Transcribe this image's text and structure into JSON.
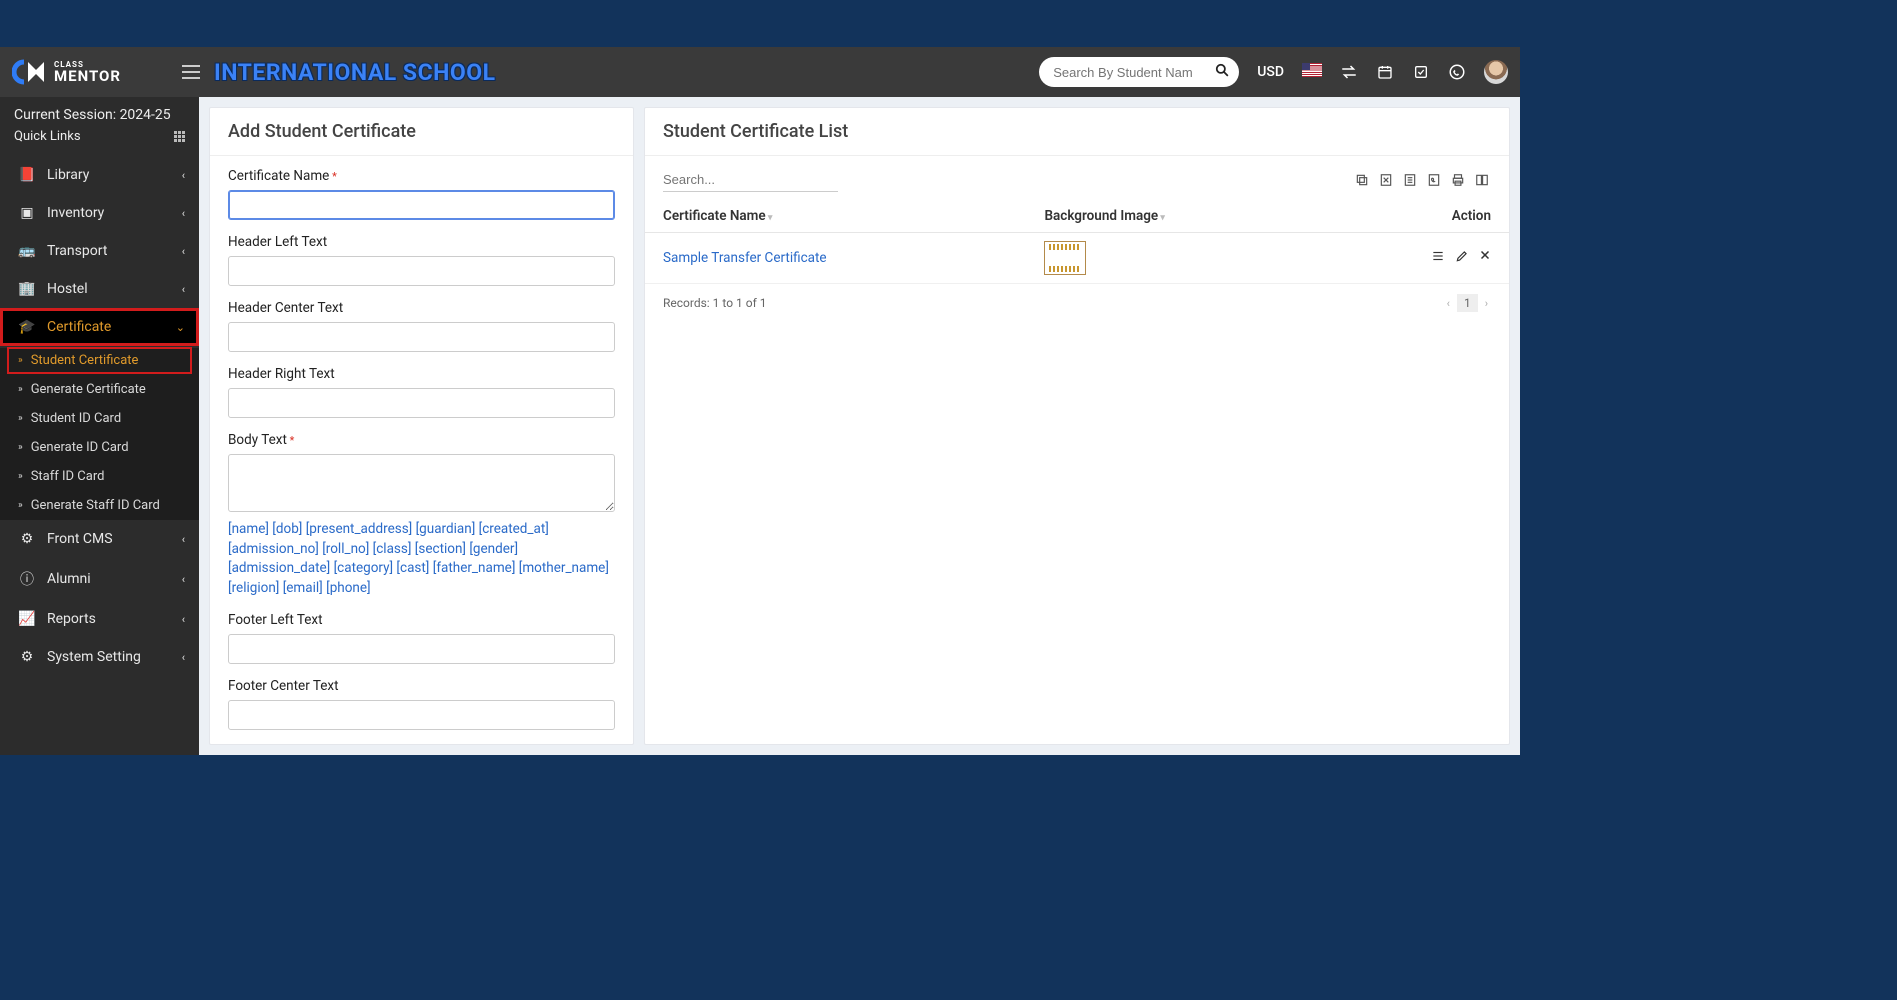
{
  "app": {
    "logo_small": "CLASS",
    "logo_big": "MENTOR",
    "title": "INTERNATIONAL SCHOOL",
    "search_placeholder": "Search By Student Nam",
    "currency": "USD"
  },
  "session": {
    "label": "Current Session: 2024-25",
    "quicklinks": "Quick Links"
  },
  "nav": {
    "library": "Library",
    "inventory": "Inventory",
    "transport": "Transport",
    "hostel": "Hostel",
    "certificate": "Certificate",
    "sub": {
      "student_certificate": "Student Certificate",
      "generate_certificate": "Generate Certificate",
      "student_id": "Student ID Card",
      "generate_id": "Generate ID Card",
      "staff_id": "Staff ID Card",
      "generate_staff_id": "Generate Staff ID Card"
    },
    "frontcms": "Front CMS",
    "alumni": "Alumni",
    "reports": "Reports",
    "system": "System Setting"
  },
  "form": {
    "title": "Add Student Certificate",
    "labels": {
      "certname": "Certificate Name",
      "header_left": "Header Left Text",
      "header_center": "Header Center Text",
      "header_right": "Header Right Text",
      "body": "Body Text",
      "footer_left": "Footer Left Text",
      "footer_center": "Footer Center Text"
    },
    "tokens": "[name] [dob] [present_address] [guardian] [created_at] [admission_no] [roll_no] [class] [section] [gender] [admission_date] [category] [cast] [father_name] [mother_name] [religion] [email] [phone]"
  },
  "list": {
    "title": "Student Certificate List",
    "search_placeholder": "Search...",
    "cols": {
      "name": "Certificate Name",
      "bg": "Background Image",
      "action": "Action"
    },
    "rows": [
      {
        "name": "Sample Transfer Certificate"
      }
    ],
    "records": "Records: 1 to 1 of 1",
    "page": "1"
  }
}
